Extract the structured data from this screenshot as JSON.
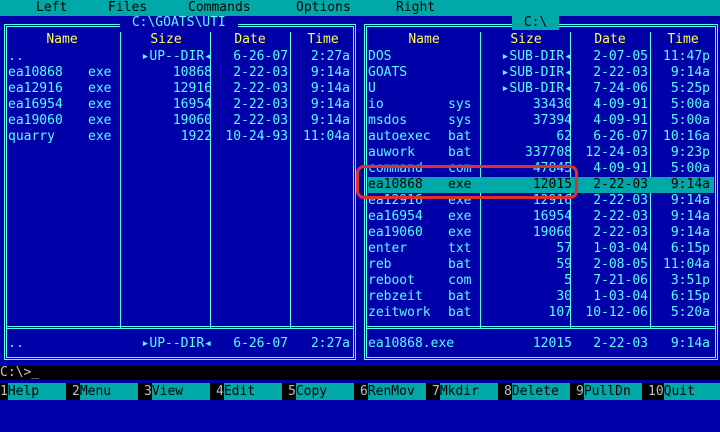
{
  "menu": {
    "left": "Left",
    "files": "Files",
    "commands": "Commands",
    "options": "Options",
    "right": "Right"
  },
  "left_panel": {
    "path": " C:\\GOATS\\UTI ",
    "headers": {
      "name": "Name",
      "size": "Size",
      "date": "Date",
      "time": "Time"
    },
    "files": [
      {
        "name": "..",
        "ext": "",
        "size": "▸UP--DIR◂",
        "date": "6-26-07",
        "time": "2:27a"
      },
      {
        "name": "ea10868",
        "ext": "exe",
        "size": "10868",
        "date": "2-22-03",
        "time": "9:14a"
      },
      {
        "name": "ea12916",
        "ext": "exe",
        "size": "12916",
        "date": "2-22-03",
        "time": "9:14a"
      },
      {
        "name": "ea16954",
        "ext": "exe",
        "size": "16954",
        "date": "2-22-03",
        "time": "9:14a"
      },
      {
        "name": "ea19060",
        "ext": "exe",
        "size": "19060",
        "date": "2-22-03",
        "time": "9:14a"
      },
      {
        "name": "quarry",
        "ext": "exe",
        "size": "1922",
        "date": "10-24-93",
        "time": "11:04a"
      }
    ],
    "status": {
      "name": "..",
      "size": "▸UP--DIR◂",
      "date": "6-26-07",
      "time": "2:27a"
    }
  },
  "right_panel": {
    "path": " C:\\ ",
    "headers": {
      "name": "Name",
      "size": "Size",
      "date": "Date",
      "time": "Time"
    },
    "files": [
      {
        "name": "DOS",
        "ext": "",
        "size": "▸SUB-DIR◂",
        "date": "2-07-05",
        "time": "11:47p"
      },
      {
        "name": "GOATS",
        "ext": "",
        "size": "▸SUB-DIR◂",
        "date": "2-22-03",
        "time": "9:14a"
      },
      {
        "name": "U",
        "ext": "",
        "size": "▸SUB-DIR◂",
        "date": "7-24-06",
        "time": "5:25p"
      },
      {
        "name": "io",
        "ext": "sys",
        "size": "33430",
        "date": "4-09-91",
        "time": "5:00a"
      },
      {
        "name": "msdos",
        "ext": "sys",
        "size": "37394",
        "date": "4-09-91",
        "time": "5:00a"
      },
      {
        "name": "autoexec",
        "ext": "bat",
        "size": "62",
        "date": "6-26-07",
        "time": "10:16a"
      },
      {
        "name": "auwork",
        "ext": "bat",
        "size": "337708",
        "date": "12-24-03",
        "time": "9:23p"
      },
      {
        "name": "command",
        "ext": "com",
        "size": "47845",
        "date": "4-09-91",
        "time": "5:00a"
      },
      {
        "name": "ea10868",
        "ext": "exe",
        "size": "12015",
        "date": "2-22-03",
        "time": "9:14a",
        "selected": true
      },
      {
        "name": "ea12916",
        "ext": "exe",
        "size": "12916",
        "date": "2-22-03",
        "time": "9:14a"
      },
      {
        "name": "ea16954",
        "ext": "exe",
        "size": "16954",
        "date": "2-22-03",
        "time": "9:14a"
      },
      {
        "name": "ea19060",
        "ext": "exe",
        "size": "19060",
        "date": "2-22-03",
        "time": "9:14a"
      },
      {
        "name": "enter",
        "ext": "txt",
        "size": "57",
        "date": "1-03-04",
        "time": "6:15p"
      },
      {
        "name": "reb",
        "ext": "bat",
        "size": "59",
        "date": "2-08-05",
        "time": "11:04a"
      },
      {
        "name": "reboot",
        "ext": "com",
        "size": "5",
        "date": "7-21-06",
        "time": "3:51p"
      },
      {
        "name": "rebzeit",
        "ext": "bat",
        "size": "30",
        "date": "1-03-04",
        "time": "6:15p"
      },
      {
        "name": "zeitwork",
        "ext": "bat",
        "size": "107",
        "date": "10-12-06",
        "time": "5:20a"
      }
    ],
    "status": {
      "name": "ea10868.exe",
      "size": "12015",
      "date": "2-22-03",
      "time": "9:14a"
    }
  },
  "command_line": "C:\\>_",
  "fkeys": [
    {
      "num": "1",
      "label": "Help"
    },
    {
      "num": "2",
      "label": "Menu"
    },
    {
      "num": "3",
      "label": "View"
    },
    {
      "num": "4",
      "label": "Edit"
    },
    {
      "num": "5",
      "label": "Copy"
    },
    {
      "num": "6",
      "label": "RenMov"
    },
    {
      "num": "7",
      "label": "Mkdir"
    },
    {
      "num": "8",
      "label": "Delete"
    },
    {
      "num": "9",
      "label": "PullDn"
    },
    {
      "num": "10",
      "label": "Quit"
    }
  ],
  "colors": {
    "panel_bg": "#0000a8",
    "text": "#55ffff",
    "header": "#ffff55",
    "cursor": "#00a8a8",
    "annotation": "#e0302a"
  }
}
